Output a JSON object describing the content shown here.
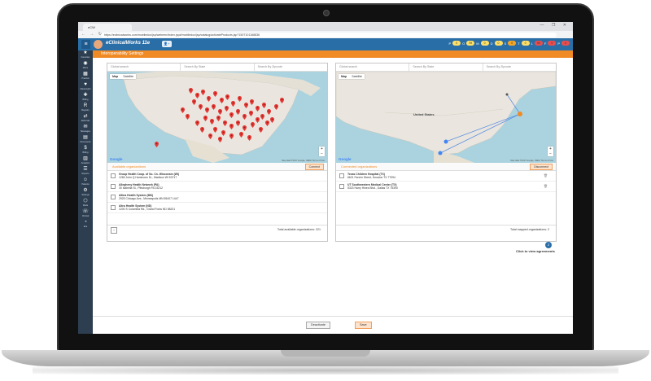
{
  "browser": {
    "tab_title": "eCW",
    "url": "https://eclinicalworks.com/mobiledoc/jsp/webemr/index.jsp#/mobiledoc/jsp/catalog/activateProducts.jsp?1507101168836"
  },
  "app": {
    "logo": "eClinicalWorks 11e",
    "page_title": "Interoperability Settings",
    "jellies": [
      {
        "label": "P",
        "value": "0",
        "color": "#ffe066"
      },
      {
        "label": "O",
        "value": "99",
        "color": "#ffe066"
      },
      {
        "label": "M",
        "value": "0",
        "color": "#ffe066"
      },
      {
        "label": "D",
        "value": "0",
        "color": "#ffe066"
      },
      {
        "label": "S",
        "value": "0",
        "color": "#f6a623"
      },
      {
        "label": "T",
        "value": "0",
        "color": "#ffe066"
      },
      {
        "label": "L",
        "value": "99",
        "color": "#e94e4e"
      },
      {
        "label": "F",
        "value": "0",
        "color": "#e94e4e"
      },
      {
        "label": "P",
        "value": "0",
        "color": "#e94e4e"
      }
    ]
  },
  "leftnav": [
    {
      "icon": "★",
      "label": "Favorites"
    },
    {
      "icon": "◉",
      "label": "Menu"
    },
    {
      "icon": "▦",
      "label": "Practice"
    },
    {
      "icon": "♥",
      "label": "Meaningful"
    },
    {
      "icon": "✚",
      "label": "Billing"
    },
    {
      "icon": "R",
      "label": "Registry"
    },
    {
      "icon": "⇄",
      "label": "Referrals"
    },
    {
      "icon": "✉",
      "label": "Messages"
    },
    {
      "icon": "▤",
      "label": "Documents"
    },
    {
      "icon": "$",
      "label": "Billing"
    },
    {
      "icon": "▥",
      "label": "Analytics"
    },
    {
      "icon": "☰",
      "label": "Reports"
    },
    {
      "icon": "☺",
      "label": "Patients"
    },
    {
      "icon": "⚙",
      "label": "Settings"
    },
    {
      "icon": "⬡",
      "label": "Meds"
    },
    {
      "icon": "☏",
      "label": "Clinical"
    },
    {
      "icon": "◔",
      "label": "Eva"
    }
  ],
  "left_panel": {
    "search_placeholder": "Global search",
    "state_placeholder": "Search By State",
    "zip_placeholder": "Search By Zipcode",
    "map_tab": "Map",
    "satellite_tab": "Satellite",
    "map_credit": "Map data ©2017 Google, INEGI   Terms of Use",
    "google": "Google",
    "section_title": "Available organizations",
    "action_button": "Connect",
    "orgs": [
      {
        "name": "Group Health Coop. of So. Cn. Wisconsin (WI)",
        "address": "1265 John Q Hammons Dr., Madison WI 53717"
      },
      {
        "name": "Allegheny Health Network (PA)",
        "address": "30 Isabella St., Pittsburgh PA 15212"
      },
      {
        "name": "Allina Health System (MN)",
        "address": "2925 Chicago Ave., Minneapolis MN 55407 1447"
      },
      {
        "name": "Altru Health System (ND)",
        "address": "1200 S Columbia Rd., Grand Forks ND 58201"
      }
    ],
    "total_label": "Total available organizations:",
    "total_value": "221"
  },
  "right_panel": {
    "search_placeholder": "Global search",
    "state_placeholder": "Search By State",
    "zip_placeholder": "Search By Zipcode",
    "map_tab": "Map",
    "satellite_tab": "Satellite",
    "map_credit": "Map data ©2017 Google, INEGI   Terms of Use",
    "google": "Google",
    "country_label": "United States",
    "section_title": "Connected organizations",
    "action_button": "Disconnect",
    "orgs": [
      {
        "name": "Texas Children Hospital (TX)",
        "address": "6621 Fannin Street, Houston TX 77094"
      },
      {
        "name": "UT Southwestern Medical Center (TX)",
        "address": "5323 Harry Hines Blvd., Dallas TX 75390"
      }
    ],
    "total_label": "Total mapped organizations:",
    "total_value": "2"
  },
  "agreements": {
    "badge": "2",
    "label": "Click to view agreements"
  },
  "footer": {
    "deactivate": "Deactivate",
    "save": "Save"
  },
  "colors": {
    "header": "#2a6ea8",
    "accent": "#f08a24",
    "nav": "#2c3e50"
  }
}
